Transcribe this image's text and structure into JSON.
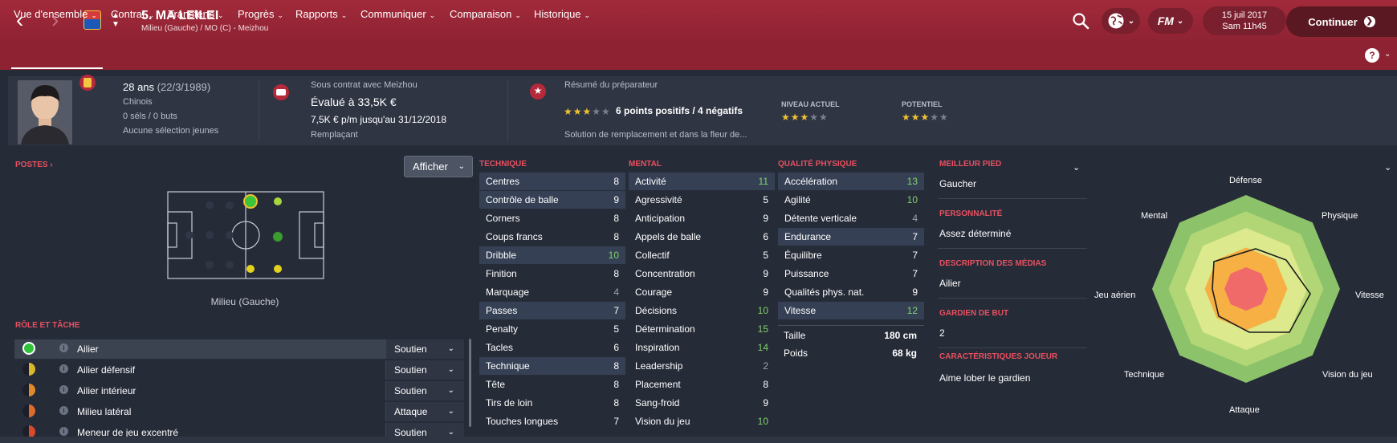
{
  "header": {
    "player_name": "5. MA LEILEI",
    "subtitle": "Milieu (Gauche) / MO (C) - Meizhou",
    "back_icon": "back-arrow-icon",
    "date": "15 juil 2017",
    "time": "Sam 11h45",
    "continue_label": "Continuer",
    "fm_label": "FM"
  },
  "tabs": [
    {
      "label": "Vue d'ensemble"
    },
    {
      "label": "Contrat"
    },
    {
      "label": "Transferts"
    },
    {
      "label": "Progrès"
    },
    {
      "label": "Rapports"
    },
    {
      "label": "Communiquer"
    },
    {
      "label": "Comparaison"
    },
    {
      "label": "Historique"
    }
  ],
  "help_label": "?",
  "profile": {
    "age": "28 ans",
    "dob": "(22/3/1989)",
    "nationality": "Chinois",
    "caps": "0 séls / 0 buts",
    "youth": "Aucune sélection jeunes",
    "contract_with": "Sous contrat avec Meizhou",
    "value": "Évalué à 33,5K €",
    "wage": "7,5K € p/m jusqu'au 31/12/2018",
    "squad_status": "Remplaçant",
    "coach_report_title": "Résumé du préparateur",
    "coach_summary": "6 points positifs / 4 négatifs",
    "coach_summary_stars": 3,
    "coach_note": "Solution de remplacement et dans la fleur de...",
    "current_ability_label": "NIVEAU ACTUEL",
    "current_ability_stars": 3,
    "potential_label": "POTENTIEL",
    "potential_stars": 3
  },
  "positions": {
    "label": "POSTES",
    "position_name": "Milieu (Gauche)",
    "afficher_label": "Afficher"
  },
  "roles": {
    "label": "RÔLE ET TÂCHE",
    "items": [
      {
        "name": "Ailier",
        "duty": "Soutien",
        "color": "#2fc23a"
      },
      {
        "name": "Ailier défensif",
        "duty": "Soutien",
        "color": "#d9b82a"
      },
      {
        "name": "Ailier intérieur",
        "duty": "Soutien",
        "color": "#e28a2a"
      },
      {
        "name": "Milieu latéral",
        "duty": "Attaque",
        "color": "#e06a2a"
      },
      {
        "name": "Meneur de jeu excentré",
        "duty": "Soutien",
        "color": "#d94a2a"
      }
    ]
  },
  "attributes": {
    "technique_label": "TECHNIQUE",
    "mental_label": "MENTAL",
    "physical_label": "QUALITÉ PHYSIQUE",
    "technique": [
      {
        "name": "Centres",
        "value": "8"
      },
      {
        "name": "Contrôle de balle",
        "value": "9"
      },
      {
        "name": "Corners",
        "value": "8"
      },
      {
        "name": "Coups francs",
        "value": "8"
      },
      {
        "name": "Dribble",
        "value": "10"
      },
      {
        "name": "Finition",
        "value": "8"
      },
      {
        "name": "Marquage",
        "value": "4"
      },
      {
        "name": "Passes",
        "value": "7"
      },
      {
        "name": "Penalty",
        "value": "5"
      },
      {
        "name": "Tacles",
        "value": "6"
      },
      {
        "name": "Technique",
        "value": "8"
      },
      {
        "name": "Tête",
        "value": "8"
      },
      {
        "name": "Tirs de loin",
        "value": "8"
      },
      {
        "name": "Touches longues",
        "value": "7"
      }
    ],
    "mental": [
      {
        "name": "Activité",
        "value": "11"
      },
      {
        "name": "Agressivité",
        "value": "5"
      },
      {
        "name": "Anticipation",
        "value": "9"
      },
      {
        "name": "Appels de balle",
        "value": "6"
      },
      {
        "name": "Collectif",
        "value": "5"
      },
      {
        "name": "Concentration",
        "value": "9"
      },
      {
        "name": "Courage",
        "value": "9"
      },
      {
        "name": "Décisions",
        "value": "10"
      },
      {
        "name": "Détermination",
        "value": "15"
      },
      {
        "name": "Inspiration",
        "value": "14"
      },
      {
        "name": "Leadership",
        "value": "2"
      },
      {
        "name": "Placement",
        "value": "8"
      },
      {
        "name": "Sang-froid",
        "value": "9"
      },
      {
        "name": "Vision du jeu",
        "value": "10"
      }
    ],
    "physical": [
      {
        "name": "Accélération",
        "value": "13"
      },
      {
        "name": "Agilité",
        "value": "10"
      },
      {
        "name": "Détente verticale",
        "value": "4"
      },
      {
        "name": "Endurance",
        "value": "7"
      },
      {
        "name": "Équilibre",
        "value": "7"
      },
      {
        "name": "Puissance",
        "value": "7"
      },
      {
        "name": "Qualités phys. nat.",
        "value": "9"
      },
      {
        "name": "Vitesse",
        "value": "12"
      }
    ],
    "height_label": "Taille",
    "height_value": "180 cm",
    "weight_label": "Poids",
    "weight_value": "68 kg"
  },
  "info": {
    "best_foot_label": "MEILLEUR PIED",
    "best_foot_value": "Gaucher",
    "personality_label": "PERSONNALITÉ",
    "personality_value": "Assez déterminé",
    "media_label": "DESCRIPTION DES MÉDIAS",
    "media_value": "Ailier",
    "gk_label": "GARDIEN DE BUT",
    "gk_value": "2",
    "traits_label": "CARACTÉRISTIQUES JOUEUR",
    "traits_value": "Aime lober le gardien"
  },
  "radar": {
    "labels": [
      "Défense",
      "Physique",
      "Vitesse",
      "Vision du jeu",
      "Attaque",
      "Technique",
      "Jeu aérien",
      "Mental"
    ]
  }
}
